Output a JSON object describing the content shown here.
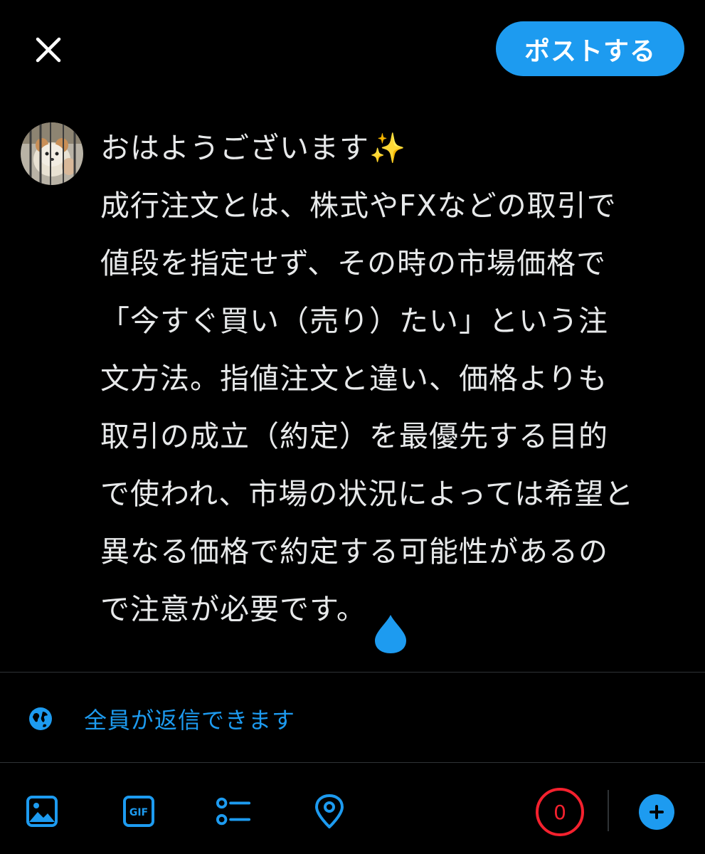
{
  "header": {
    "close_icon": "close-icon",
    "post_label": "ポストする",
    "accent_color": "#1d9bf0"
  },
  "compose": {
    "lines": [
      "おはようございます✨",
      "成行注文とは、株式やFXなどの取引で",
      "値段を指定せず、その時の市場価格で",
      "「今すぐ買い（売り）たい」という注",
      "文方法。指値注文と違い、価格よりも",
      "取引の成立（約定）を最優先する目的",
      "で使われ、市場の状況によっては希望と",
      "異なる価格で約定する可能性があるの",
      "で注意が必要です。"
    ]
  },
  "reply_setting": {
    "icon": "globe-icon",
    "label": "全員が返信できます"
  },
  "toolbar": {
    "items": [
      "image-icon",
      "gif-icon",
      "poll-icon",
      "location-icon"
    ],
    "char_counter": "0",
    "counter_color": "#f4212e",
    "add_icon": "plus-icon"
  }
}
